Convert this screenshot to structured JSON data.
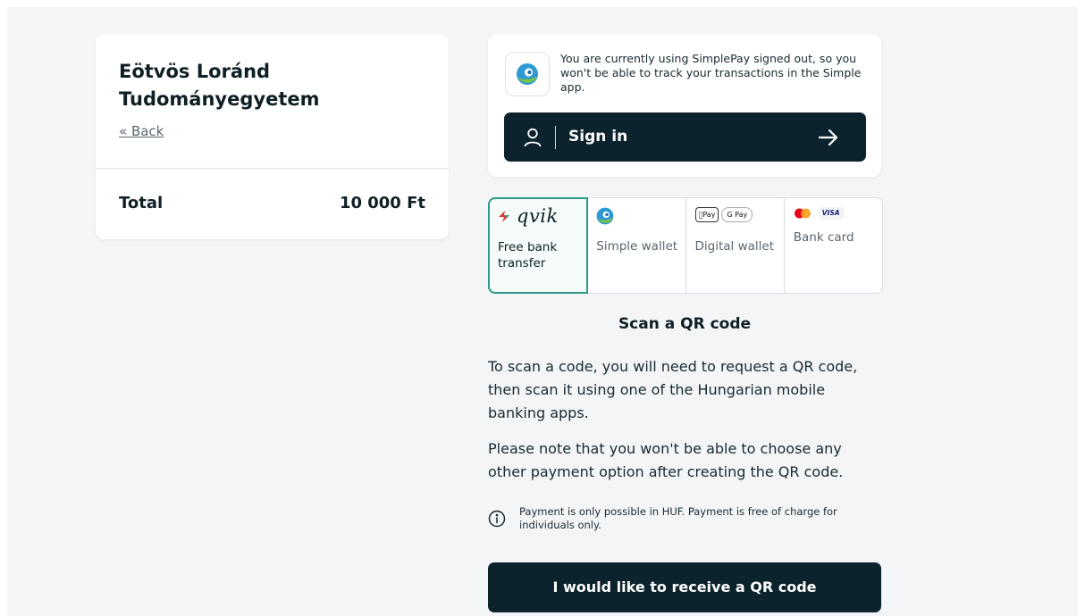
{
  "merchant": {
    "name": "Eötvös Loránd Tudományegyetem",
    "back_label": "« Back",
    "total_label": "Total",
    "total_value": "10 000 Ft"
  },
  "signin": {
    "notice": "You are currently using SimplePay signed out, so you won't be able to track your transactions in the Simple app.",
    "button_label": "Sign in",
    "icon_user": "user-icon",
    "icon_arrow": "arrow-right-icon"
  },
  "payment_methods": [
    {
      "logo_text": "qvik",
      "label": "Free bank transfer",
      "selected": true
    },
    {
      "label": "Simple wallet",
      "selected": false
    },
    {
      "logo_apple": "Pay",
      "logo_google": "G Pay",
      "label": "Digital wallet",
      "selected": false
    },
    {
      "logo_visa": "VISA",
      "label": "Bank card",
      "selected": false
    }
  ],
  "scan": {
    "title": "Scan a QR code",
    "paragraph1": "To scan a code, you will need to request a QR code, then scan it using one of the Hungarian mobile banking apps.",
    "paragraph2": "Please note that you won't be able to choose any other payment option after creating the QR code.",
    "info": "Payment is only possible in HUF. Payment is free of charge for individuals only.",
    "button_label": "I would like to receive a QR code"
  },
  "colors": {
    "dark_navy": "#0c232d",
    "selected_border": "#2e9a84",
    "background": "#f4f5f7"
  }
}
